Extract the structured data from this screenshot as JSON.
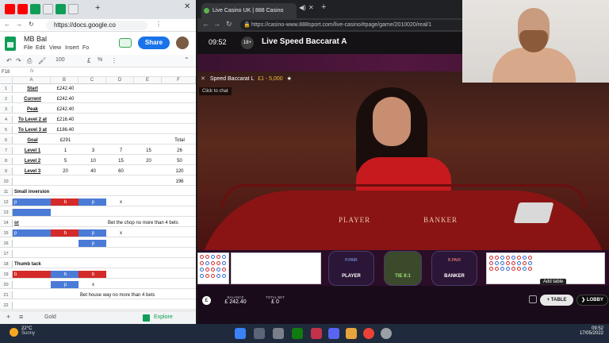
{
  "left_browser": {
    "url": "https://docs.google.co",
    "doc_title": "MB Bal",
    "menu": [
      "File",
      "Edit",
      "View",
      "Insert",
      "Fo"
    ],
    "share_label": "Share",
    "cell_ref": "F18",
    "toolbar_zoom": "100",
    "columns": [
      "A",
      "B",
      "C",
      "D",
      "E",
      "F"
    ],
    "rows": [
      {
        "n": "1",
        "a": "Start",
        "b": "£242.40"
      },
      {
        "n": "2",
        "a": "Current",
        "b": "£242.40"
      },
      {
        "n": "3",
        "a": "Peak",
        "b": "£242.40"
      },
      {
        "n": "4",
        "a": "To Level 2 at",
        "b": "£216.40"
      },
      {
        "n": "5",
        "a": "To Level 3 at",
        "b": "£186.40"
      },
      {
        "n": "6",
        "a": "Goal",
        "b": "£291",
        "f": "Total"
      },
      {
        "n": "7",
        "a": "Level 1",
        "b": "1",
        "c": "3",
        "d": "7",
        "e": "15",
        "f": "26"
      },
      {
        "n": "8",
        "a": "Level 2",
        "b": "5",
        "c": "10",
        "d": "15",
        "e": "20",
        "f": "50"
      },
      {
        "n": "9",
        "a": "Level 3",
        "b": "20",
        "c": "40",
        "d": "60",
        "f": "120"
      },
      {
        "n": "10",
        "f": "196"
      },
      {
        "n": "11",
        "a": "Small inversion"
      },
      {
        "n": "12",
        "a": "p",
        "b": "b",
        "c": "p",
        "d": "x"
      },
      {
        "n": "13"
      },
      {
        "n": "14",
        "a": "or",
        "d": "Bet the chop no more than 4 bets"
      },
      {
        "n": "15",
        "a": "p",
        "b": "b",
        "c": "p",
        "d": "x"
      },
      {
        "n": "16",
        "c": "p"
      },
      {
        "n": "17"
      },
      {
        "n": "18",
        "a": "Thumb tack"
      },
      {
        "n": "19",
        "a": "b",
        "b": "b",
        "c": "b"
      },
      {
        "n": "20",
        "b": "p",
        "c": "x"
      },
      {
        "n": "21",
        "c": "Bet house way no more than 4 bets"
      },
      {
        "n": "22"
      }
    ],
    "sheet_tabs": [
      "Gold"
    ],
    "explore_label": "Explore"
  },
  "right_browser": {
    "tab_title": "Live Casino UK | 888 Casino",
    "url": "https://casino-www.888sport.com/live-casino/#page/game/2010020/real/1",
    "game_time": "09:52",
    "age_badge": "18+",
    "game_title": "Live Speed Baccarat A",
    "table_name": "Speed Baccarat L",
    "table_limits": "£1 - 5,000",
    "chat_hint": "Click to chat",
    "table_label_player": "PLAYER",
    "table_label_banker": "BANKER",
    "bets": {
      "player": "PLAYER",
      "tie": "TIE 8:1",
      "banker": "BANKER",
      "player_pair": "P.PAIR",
      "banker_pair": "B.PAIR"
    },
    "balance_label": "BALANCE",
    "balance_value": "£ 242.40",
    "total_bet_label": "TOTAL BET",
    "total_bet_value": "£ 0",
    "add_table_label": "TABLE",
    "add_table_tooltip": "Add table",
    "lobby_label": "LOBBY"
  },
  "taskbar": {
    "weather_temp": "22°C",
    "weather_desc": "Sunny",
    "time": "09:52",
    "date": "17/05/2022"
  }
}
